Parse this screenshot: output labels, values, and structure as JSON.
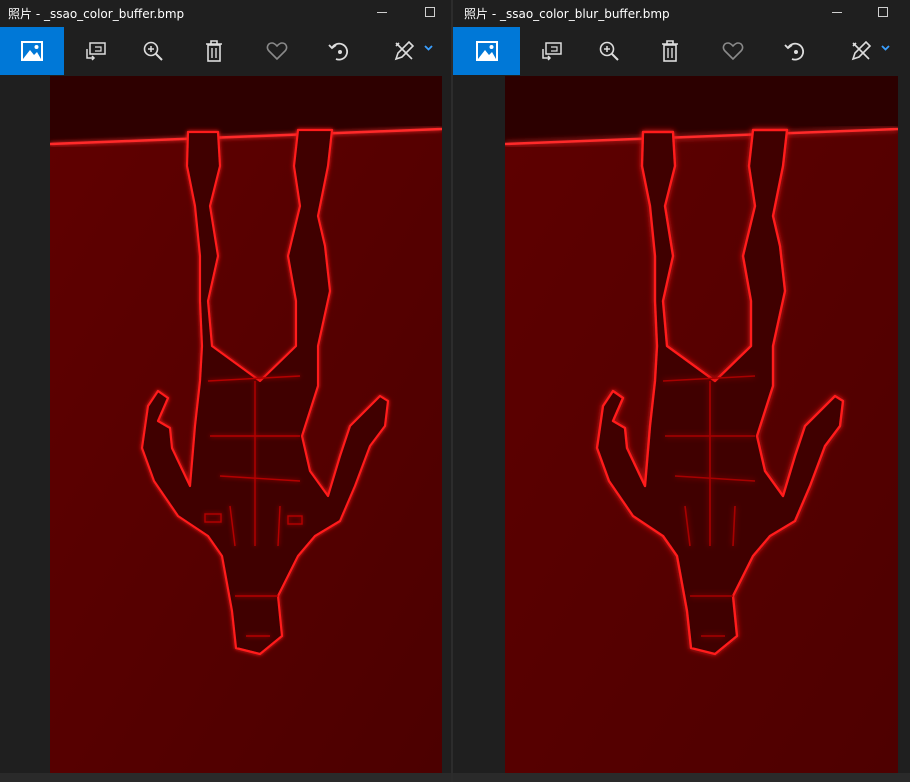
{
  "windows": [
    {
      "title": "照片 - _ssao_color_buffer.bmp",
      "toolbar": [
        "photo-icon",
        "slideshow-icon",
        "zoom-in-icon",
        "delete-icon",
        "heart-icon",
        "rotate-icon",
        "edit-icon",
        "chevron-down-icon"
      ],
      "image": "_ssao_color_buffer.bmp"
    },
    {
      "title": "照片 - _ssao_color_blur_buffer.bmp",
      "toolbar": [
        "photo-icon",
        "slideshow-icon",
        "zoom-in-icon",
        "delete-icon",
        "heart-icon",
        "rotate-icon",
        "edit-icon",
        "chevron-down-icon"
      ],
      "image": "_ssao_color_blur_buffer.bmp"
    }
  ],
  "colors": {
    "accent": "#0078d7",
    "background": "#1f1f1f",
    "image_base": "#5a0000",
    "edge_glow": "#ff1a1a"
  }
}
